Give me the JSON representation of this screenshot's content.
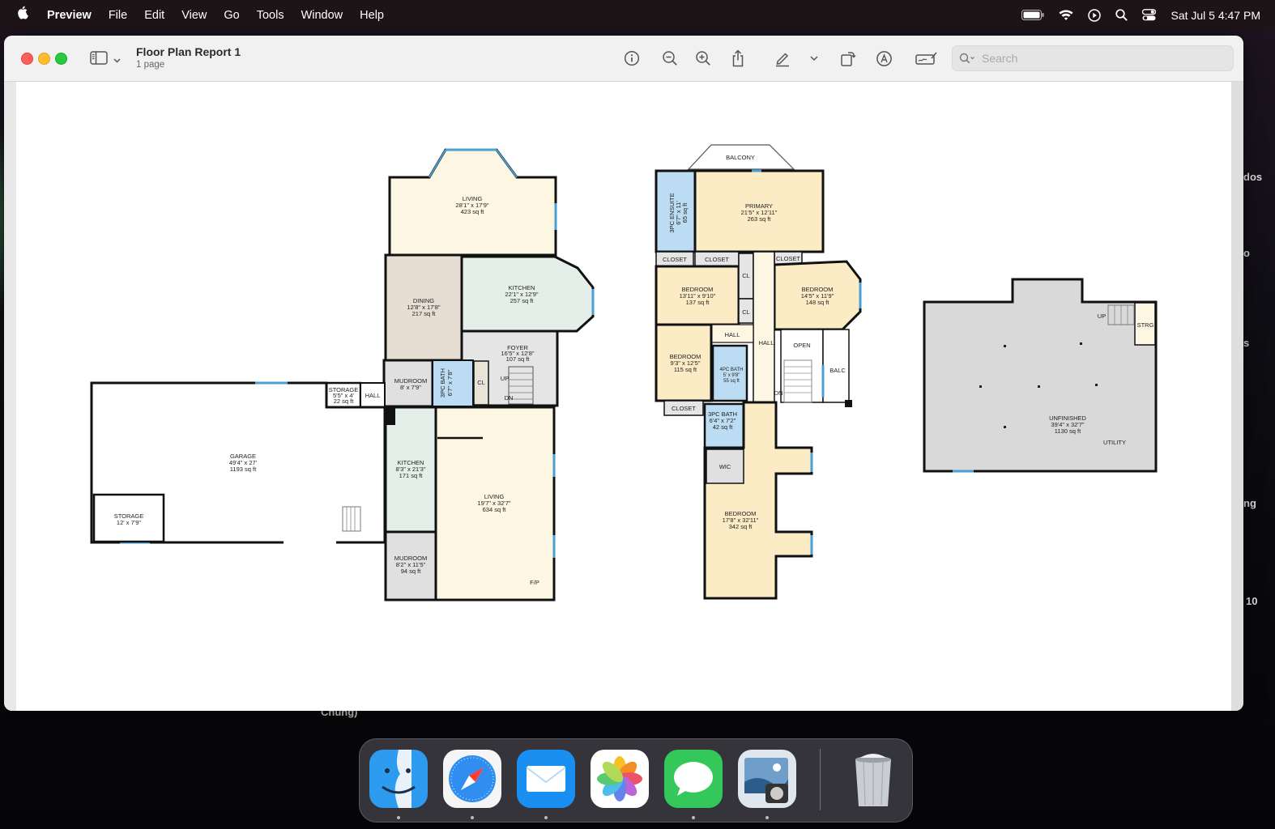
{
  "menubar": {
    "app_name": "Preview",
    "items": [
      "File",
      "Edit",
      "View",
      "Go",
      "Tools",
      "Window",
      "Help"
    ],
    "clock": "Sat Jul 5  4:47 PM"
  },
  "desktop_labels": [
    "dos",
    "o",
    "s",
    "ng",
    "10",
    "Chung)"
  ],
  "window": {
    "title": "Floor Plan Report 1",
    "subtitle": "1 page",
    "search_placeholder": "Search"
  },
  "floorplan": {
    "main": [
      {
        "name": "LIVING",
        "dims": "28'1\" x 17'9\"",
        "area": "423 sq ft"
      },
      {
        "name": "DINING",
        "dims": "12'8\" x 17'8\"",
        "area": "217 sq ft"
      },
      {
        "name": "KITCHEN",
        "dims": "22'1\" x 12'9\"",
        "area": "257 sq ft"
      },
      {
        "name": "FOYER",
        "dims": "16'5\" x 12'8\"",
        "area": "107 sq ft"
      },
      {
        "name": "MUDROOM",
        "dims": "8' x 7'9\""
      },
      {
        "name": "3PC BATH",
        "dims": "6'7\" x 7'8\""
      },
      {
        "name": "STORAGE",
        "dims": "5'5\" x 4'",
        "area": "22 sq ft"
      },
      {
        "name": "HALL"
      },
      {
        "name": "GARAGE",
        "dims": "49'4\" x 27'",
        "area": "1193 sq ft"
      },
      {
        "name": "STORAGE",
        "dims": "12' x 7'9\""
      },
      {
        "name": "KITCHEN",
        "dims": "8'3\" x 21'3\"",
        "area": "171 sq ft"
      },
      {
        "name": "LIVING",
        "dims": "19'7\" x 32'7\"",
        "area": "634 sq ft"
      },
      {
        "name": "MUDROOM",
        "dims": "8'2\" x 11'5\"",
        "area": "94 sq ft"
      },
      {
        "name": "F/P"
      },
      {
        "name": "CL"
      },
      {
        "name": "UP"
      },
      {
        "name": "DN"
      }
    ],
    "upper": [
      {
        "name": "BALCONY"
      },
      {
        "name": "3PC ENSUITE",
        "dims": "6'7\" x 11'",
        "area": "65 sq ft"
      },
      {
        "name": "PRIMARY",
        "dims": "21'5\" x 12'11\"",
        "area": "263 sq ft"
      },
      {
        "name": "CLOSET"
      },
      {
        "name": "CLOSET"
      },
      {
        "name": "CLOSET"
      },
      {
        "name": "BEDROOM",
        "dims": "13'11\" x 9'10\"",
        "area": "137 sq ft"
      },
      {
        "name": "BEDROOM",
        "dims": "14'5\" x 11'9\"",
        "area": "148 sq ft"
      },
      {
        "name": "CL"
      },
      {
        "name": "CL"
      },
      {
        "name": "HALL"
      },
      {
        "name": "HALL"
      },
      {
        "name": "OPEN"
      },
      {
        "name": "BEDROOM",
        "dims": "9'3\" x 12'5\"",
        "area": "115 sq ft"
      },
      {
        "name": "4PC BATH",
        "dims": "5' x 9'8\"",
        "area": "55 sq ft"
      },
      {
        "name": "BALC"
      },
      {
        "name": "DN"
      },
      {
        "name": "CLOSET"
      },
      {
        "name": "3PC BATH",
        "dims": "6'4\" x 7'2\"",
        "area": "42 sq ft"
      },
      {
        "name": "WIC"
      },
      {
        "name": "BEDROOM",
        "dims": "17'8\" x 32'11\"",
        "area": "342 sq ft"
      }
    ],
    "basement": [
      {
        "name": "UP"
      },
      {
        "name": "STRG"
      },
      {
        "name": "UNFINISHED",
        "dims": "39'4\" x 32'7\"",
        "area": "1130 sq ft"
      },
      {
        "name": "UTILITY"
      }
    ]
  },
  "dock": {
    "apps": [
      "finder-icon",
      "safari-icon",
      "mail-icon",
      "photos-icon",
      "messages-icon",
      "preview-icon",
      "trash-icon"
    ]
  },
  "colors": {
    "living": "#fdf6e3",
    "dining": "#e6ddd3",
    "kitchen": "#e3efe8",
    "bath": "#bcdcf3",
    "hall": "#e5e5e5",
    "bedroom": "#fcecc6",
    "unfinished": "#d9d9d9",
    "wall": "#111111",
    "window": "#4a9fd4"
  }
}
